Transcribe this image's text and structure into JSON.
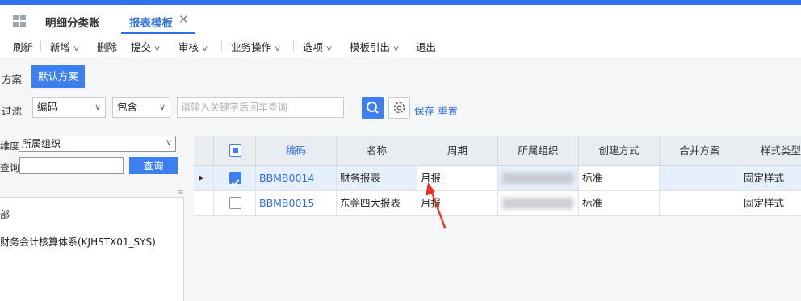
{
  "tabs": {
    "tab1": "明细分类账",
    "tab2": "报表模板",
    "close": "✕"
  },
  "toolbar": {
    "refresh": "刷新",
    "add": "新增",
    "delete": "删除",
    "submit": "提交",
    "audit": "审核",
    "business": "业务操作",
    "options": "选项",
    "template_export": "模板引出",
    "exit": "退出"
  },
  "plan": {
    "label": "方案",
    "default": "默认方案"
  },
  "filter": {
    "label": "过滤",
    "field": "编码",
    "operator": "包含",
    "placeholder": "请输入关键字后回车查询",
    "save": "保存",
    "reset": "重置"
  },
  "left_panel": {
    "dimension_label": "维度",
    "dimension_value": "所属组织",
    "query_label": "查询",
    "query_button": "查询",
    "tree": [
      "部",
      "财务会计核算体系(KJHSTX01_SYS)"
    ]
  },
  "table": {
    "columns": [
      "编码",
      "名称",
      "周期",
      "所属组织",
      "创建方式",
      "合并方案",
      "样式类型"
    ],
    "rows": [
      {
        "checked": true,
        "code": "BBMB0014",
        "name": "财务报表",
        "period": "月报",
        "org": "",
        "create": "标准",
        "merge": "",
        "style": "固定样式"
      },
      {
        "checked": false,
        "code": "BBMB0015",
        "name": "东莞四大报表",
        "period": "月报",
        "org": "",
        "create": "标准",
        "merge": "",
        "style": "固定样式"
      }
    ]
  },
  "colors": {
    "accent": "#2f6fe5",
    "button": "#3c7ff0",
    "annotation_arrow": "#e8332a"
  }
}
